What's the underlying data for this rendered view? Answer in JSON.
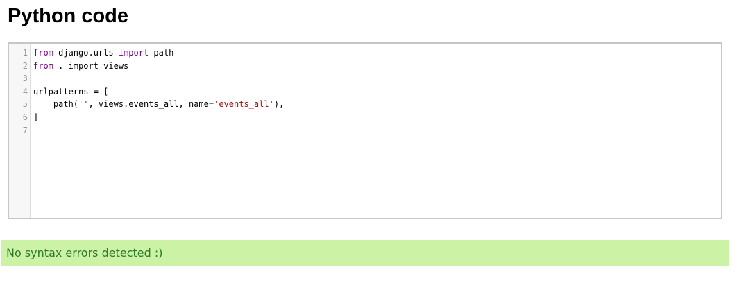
{
  "page": {
    "title": "Python code"
  },
  "editor": {
    "line_numbers": [
      "1",
      "2",
      "3",
      "4",
      "5",
      "6",
      "7"
    ],
    "lines": [
      [
        {
          "t": "from",
          "c": "kw"
        },
        {
          "t": " django.urls ",
          "c": ""
        },
        {
          "t": "import",
          "c": "kw"
        },
        {
          "t": " path",
          "c": ""
        }
      ],
      [
        {
          "t": "from",
          "c": "kw"
        },
        {
          "t": " . import views",
          "c": ""
        }
      ],
      [],
      [
        {
          "t": "urlpatterns = [",
          "c": ""
        }
      ],
      [
        {
          "t": "    path(",
          "c": ""
        },
        {
          "t": "''",
          "c": "str"
        },
        {
          "t": ", views.events_all, name=",
          "c": ""
        },
        {
          "t": "'events_all'",
          "c": "str"
        },
        {
          "t": "),",
          "c": ""
        }
      ],
      [
        {
          "t": "]",
          "c": ""
        }
      ],
      []
    ]
  },
  "status": {
    "message": "No syntax errors detected :)"
  },
  "colors": {
    "keyword": "#770088",
    "string": "#aa1111",
    "status_background": "#ccf2a6",
    "status_text": "#2c7a2c"
  }
}
